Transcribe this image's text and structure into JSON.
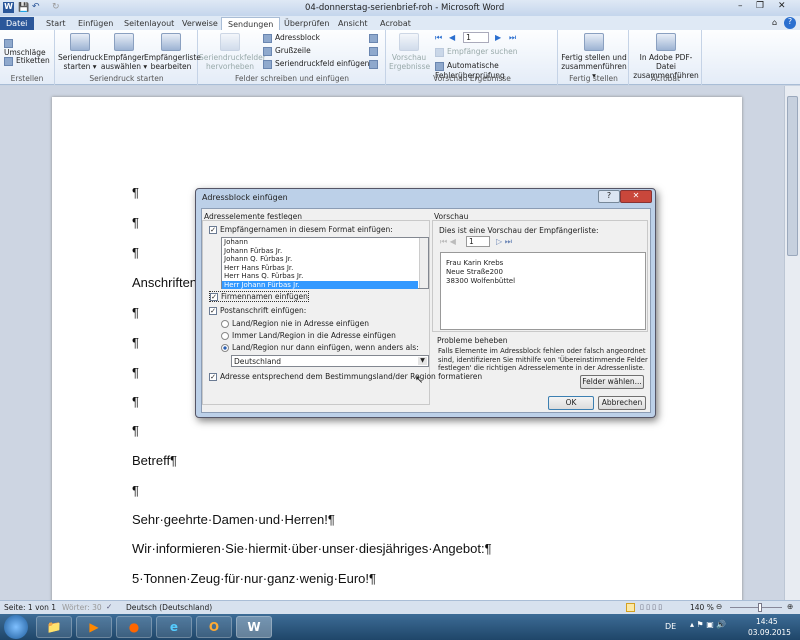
{
  "window": {
    "title": "04-donnerstag-serienbrief-roh - Microsoft Word",
    "app_icon": "W"
  },
  "tabs": [
    "Datei",
    "Start",
    "Einfügen",
    "Seitenlayout",
    "Verweise",
    "Sendungen",
    "Überprüfen",
    "Ansicht",
    "Acrobat"
  ],
  "ribbon": {
    "erstellen": {
      "label": "Erstellen",
      "umschlaege": "Umschläge",
      "etiketten": "Etiketten"
    },
    "seriendruck": {
      "label": "Seriendruck starten",
      "starten": [
        "Seriendruck",
        "starten ▾"
      ],
      "empfaenger": [
        "Empfänger",
        "auswählen ▾"
      ],
      "liste": [
        "Empfängerliste",
        "bearbeiten"
      ]
    },
    "felder": {
      "label": "Felder schreiben und einfügen",
      "hervorheben": [
        "Seriendruckfelder",
        "hervorheben"
      ],
      "adressblock": "Adressblock",
      "grusszeile": "Grußzeile",
      "feld_einfuegen": "Seriendruckfeld einfügen ▾"
    },
    "vorschau": {
      "label": "Vorschau Ergebnisse",
      "button": [
        "Vorschau",
        "Ergebnisse"
      ],
      "record": "1",
      "suchen": "Empfänger suchen",
      "fehler": "Automatische Fehlerüberprüfung"
    },
    "fertig": {
      "label": "Fertig stellen",
      "button": [
        "Fertig stellen und",
        "zusammenführen ▾"
      ]
    },
    "acrobat": {
      "label": "Acrobat",
      "button": [
        "In Adobe PDF-Datei",
        "zusammenführen"
      ]
    }
  },
  "document": {
    "paragraphs": [
      "¶",
      "¶",
      "¶",
      "Anschriftenfe",
      "¶",
      "¶",
      "¶",
      "¶",
      "¶",
      "Betreff¶",
      "¶",
      "Sehr·geehrte·Damen·und·Herren!¶",
      "Wir·informieren·Sie·hiermit·über·unser·diesjähriges·Angebot:¶",
      "5·Tonnen·Zeug·für·nur·ganz·wenig·Euro!¶"
    ]
  },
  "dialog": {
    "title": "Adressblock einfügen",
    "help": "?",
    "close": "✕",
    "left_group": "Adresselemente festlegen",
    "name_check": "Empfängernamen in diesem Format einfügen:",
    "name_formats": [
      "Johann",
      "Johann Fürbas Jr.",
      "Johann Q. Fürbas Jr.",
      "Herr Hans Fürbas Jr.",
      "Herr Hans Q. Fürbas Jr.",
      "Herr Johann Fürbas Jr."
    ],
    "firm_check": "Firmennamen einfügen",
    "post_check": "Postanschrift einfügen:",
    "radio": [
      "Land/Region nie in Adresse einfügen",
      "Immer Land/Region in die Adresse einfügen",
      "Land/Region nur dann einfügen, wenn anders als:"
    ],
    "country": "Deutschland",
    "format_check": "Adresse entsprechend dem Bestimmungsland/der Region formatieren",
    "right_group": "Vorschau",
    "preview_caption": "Dies ist eine Vorschau der Empfängerliste:",
    "preview_record": "1",
    "preview_lines": [
      "Frau Karin Krebs",
      "Neue Straße200",
      "38300 Wolfenbüttel"
    ],
    "problems_title": "Probleme beheben",
    "problems_text": "Falls Elemente im Adressblock fehlen oder falsch angeordnet sind, identifizieren Sie mithilfe von 'Übereinstimmende Felder festlegen' die richtigen Adresselemente in der Adressenliste.",
    "felder_button": "Felder wählen...",
    "ok": "OK",
    "cancel": "Abbrechen"
  },
  "status": {
    "page": "Seite: 1 von 1",
    "words": "Wörter: 30",
    "language": "Deutsch (Deutschland)",
    "zoom": "140 %"
  },
  "taskbar": {
    "lang": "DE",
    "time": "14:45",
    "date": "03.09.2015"
  }
}
